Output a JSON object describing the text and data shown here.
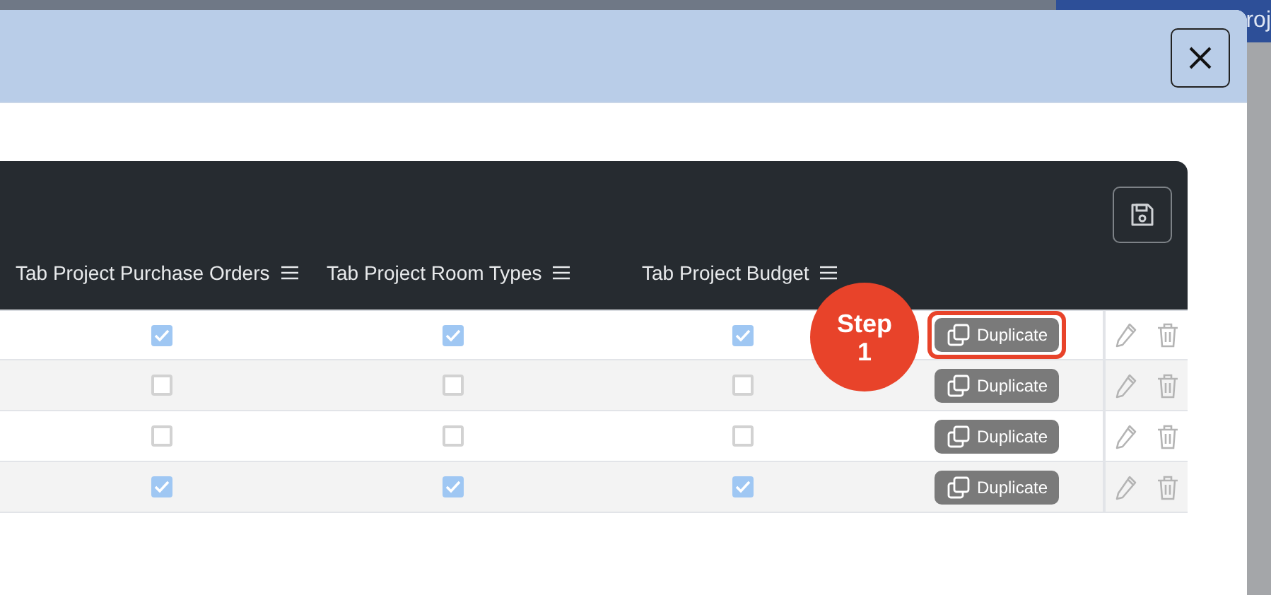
{
  "background": {
    "tab_text": "roj"
  },
  "columns": [
    "Tab Project Purchase Orders",
    "Tab Project Room Types",
    "Tab Project Budget"
  ],
  "rows": [
    {
      "checks": [
        true,
        true,
        true
      ],
      "action": "Duplicate",
      "highlighted": true
    },
    {
      "checks": [
        false,
        false,
        false
      ],
      "action": "Duplicate",
      "highlighted": false
    },
    {
      "checks": [
        false,
        false,
        false
      ],
      "action": "Duplicate",
      "highlighted": false
    },
    {
      "checks": [
        true,
        true,
        true
      ],
      "action": "Duplicate",
      "highlighted": false
    }
  ],
  "step_badge": {
    "label": "Step",
    "number": "1"
  }
}
